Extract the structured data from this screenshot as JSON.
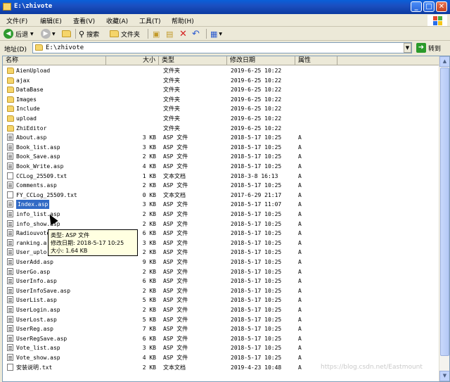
{
  "window": {
    "title": "E:\\zhivote",
    "buttons": {
      "minimize": "_",
      "maximize": "□",
      "close": "✕"
    }
  },
  "menu": [
    "文件(F)",
    "编辑(E)",
    "查看(V)",
    "收藏(A)",
    "工具(T)",
    "帮助(H)"
  ],
  "toolbar": {
    "back": "后退",
    "search": "搜索",
    "folders": "文件夹"
  },
  "address": {
    "label": "地址(D)",
    "value": "E:\\zhivote",
    "go": "转到"
  },
  "columns": {
    "name": "名称",
    "size": "大小",
    "type": "类型",
    "modified": "修改日期",
    "attr": "属性"
  },
  "files": [
    {
      "name": "AienUpload",
      "size": "",
      "type": "文件夹",
      "date": "2019-6-25 10:22",
      "attr": "",
      "kind": "folder"
    },
    {
      "name": "ajax",
      "size": "",
      "type": "文件夹",
      "date": "2019-6-25 10:22",
      "attr": "",
      "kind": "folder"
    },
    {
      "name": "DataBase",
      "size": "",
      "type": "文件夹",
      "date": "2019-6-25 10:22",
      "attr": "",
      "kind": "folder"
    },
    {
      "name": "Images",
      "size": "",
      "type": "文件夹",
      "date": "2019-6-25 10:22",
      "attr": "",
      "kind": "folder"
    },
    {
      "name": "Include",
      "size": "",
      "type": "文件夹",
      "date": "2019-6-25 10:22",
      "attr": "",
      "kind": "folder"
    },
    {
      "name": "upload",
      "size": "",
      "type": "文件夹",
      "date": "2019-6-25 10:22",
      "attr": "",
      "kind": "folder"
    },
    {
      "name": "ZhiEditor",
      "size": "",
      "type": "文件夹",
      "date": "2019-6-25 10:22",
      "attr": "",
      "kind": "folder"
    },
    {
      "name": "About.asp",
      "size": "3 KB",
      "type": "ASP 文件",
      "date": "2018-5-17 10:25",
      "attr": "A",
      "kind": "file"
    },
    {
      "name": "Book_list.asp",
      "size": "3 KB",
      "type": "ASP 文件",
      "date": "2018-5-17 10:25",
      "attr": "A",
      "kind": "file"
    },
    {
      "name": "Book_Save.asp",
      "size": "2 KB",
      "type": "ASP 文件",
      "date": "2018-5-17 10:25",
      "attr": "A",
      "kind": "file"
    },
    {
      "name": "Book_Write.asp",
      "size": "4 KB",
      "type": "ASP 文件",
      "date": "2018-5-17 10:25",
      "attr": "A",
      "kind": "file"
    },
    {
      "name": "CCLog_25509.txt",
      "size": "1 KB",
      "type": "文本文档",
      "date": "2018-3-8 16:13",
      "attr": "A",
      "kind": "txt"
    },
    {
      "name": "Comments.asp",
      "size": "2 KB",
      "type": "ASP 文件",
      "date": "2018-5-17 10:25",
      "attr": "A",
      "kind": "file"
    },
    {
      "name": "FY_CCLog_25509.txt",
      "size": "0 KB",
      "type": "文本文档",
      "date": "2017-6-29 21:17",
      "attr": "A",
      "kind": "txt"
    },
    {
      "name": "Index.asp",
      "size": "3 KB",
      "type": "ASP 文件",
      "date": "2018-5-17 11:07",
      "attr": "A",
      "kind": "file",
      "selected": true
    },
    {
      "name": "info_list.asp",
      "size": "2 KB",
      "type": "ASP 文件",
      "date": "2018-5-17 10:25",
      "attr": "A",
      "kind": "file"
    },
    {
      "name": "info_show.asp",
      "size": "2 KB",
      "type": "ASP 文件",
      "date": "2018-5-17 10:25",
      "attr": "A",
      "kind": "file"
    },
    {
      "name": "Radiouvote",
      "size": "6 KB",
      "type": "ASP 文件",
      "date": "2018-5-17 10:25",
      "attr": "A",
      "kind": "file"
    },
    {
      "name": "ranking.a",
      "size": "3 KB",
      "type": "ASP 文件",
      "date": "2018-5-17 10:25",
      "attr": "A",
      "kind": "file"
    },
    {
      "name": "User_uplo",
      "size": "2 KB",
      "type": "ASP 文件",
      "date": "2018-5-17 10:25",
      "attr": "A",
      "kind": "file"
    },
    {
      "name": "UserAdd.asp",
      "size": "9 KB",
      "type": "ASP 文件",
      "date": "2018-5-17 10:25",
      "attr": "A",
      "kind": "file"
    },
    {
      "name": "UserGo.asp",
      "size": "2 KB",
      "type": "ASP 文件",
      "date": "2018-5-17 10:25",
      "attr": "A",
      "kind": "file"
    },
    {
      "name": "UserInfo.asp",
      "size": "6 KB",
      "type": "ASP 文件",
      "date": "2018-5-17 10:25",
      "attr": "A",
      "kind": "file"
    },
    {
      "name": "UserInfoSave.asp",
      "size": "2 KB",
      "type": "ASP 文件",
      "date": "2018-5-17 10:25",
      "attr": "A",
      "kind": "file"
    },
    {
      "name": "UserList.asp",
      "size": "5 KB",
      "type": "ASP 文件",
      "date": "2018-5-17 10:25",
      "attr": "A",
      "kind": "file"
    },
    {
      "name": "UserLogin.asp",
      "size": "2 KB",
      "type": "ASP 文件",
      "date": "2018-5-17 10:25",
      "attr": "A",
      "kind": "file"
    },
    {
      "name": "UserLost.asp",
      "size": "5 KB",
      "type": "ASP 文件",
      "date": "2018-5-17 10:25",
      "attr": "A",
      "kind": "file"
    },
    {
      "name": "UserReg.asp",
      "size": "7 KB",
      "type": "ASP 文件",
      "date": "2018-5-17 10:25",
      "attr": "A",
      "kind": "file"
    },
    {
      "name": "UserRegSave.asp",
      "size": "6 KB",
      "type": "ASP 文件",
      "date": "2018-5-17 10:25",
      "attr": "A",
      "kind": "file"
    },
    {
      "name": "Vote_list.asp",
      "size": "3 KB",
      "type": "ASP 文件",
      "date": "2018-5-17 10:25",
      "attr": "A",
      "kind": "file"
    },
    {
      "name": "Vote_show.asp",
      "size": "4 KB",
      "type": "ASP 文件",
      "date": "2018-5-17 10:25",
      "attr": "A",
      "kind": "file"
    },
    {
      "name": "安装说明.txt",
      "size": "2 KB",
      "type": "文本文档",
      "date": "2019-4-23 10:48",
      "attr": "A",
      "kind": "txt"
    }
  ],
  "tooltip": {
    "line1": "类型: ASP 文件",
    "line2": "修改日期: 2018-5-17 10:25",
    "line3": "大小: 1.64 KB"
  },
  "watermark": "https://blog.csdn.net/Eastmount",
  "colors": {
    "titlebar": "#0b3aa0",
    "selection": "#316ac5",
    "tooltip_bg": "#ffffe1"
  }
}
